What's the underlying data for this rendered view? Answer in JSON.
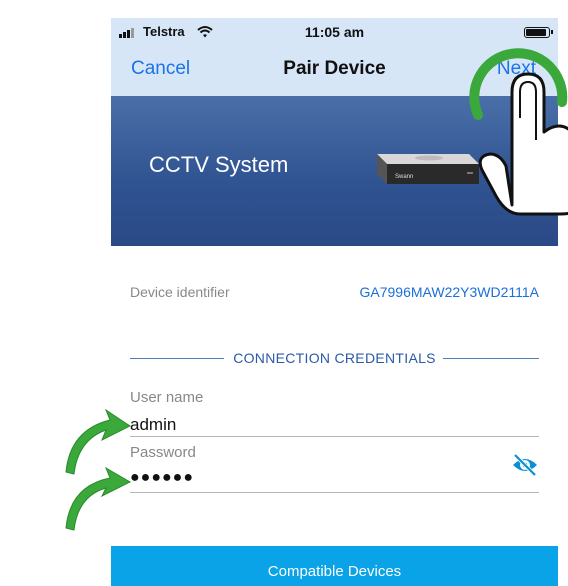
{
  "statusbar": {
    "carrier": "Telstra",
    "time": "11:05 am"
  },
  "navbar": {
    "cancel_label": "Cancel",
    "title": "Pair Device",
    "next_label": "Next"
  },
  "hero": {
    "title": "CCTV System",
    "device_brand": "Swann"
  },
  "device": {
    "identifier_label": "Device identifier",
    "identifier_value": "GA7996MAW22Y3WD2111A"
  },
  "credentials": {
    "section_title": "CONNECTION CREDENTIALS",
    "username_label": "User name",
    "username_value": "admin",
    "password_label": "Password",
    "password_value": "●●●●●●"
  },
  "footer": {
    "button_label": "Compatible Devices"
  },
  "colors": {
    "accent_blue": "#1a73e8",
    "nav_background": "#d6e6f7",
    "button_background": "#0aa3e8",
    "annotation_green": "#3aa83a"
  }
}
